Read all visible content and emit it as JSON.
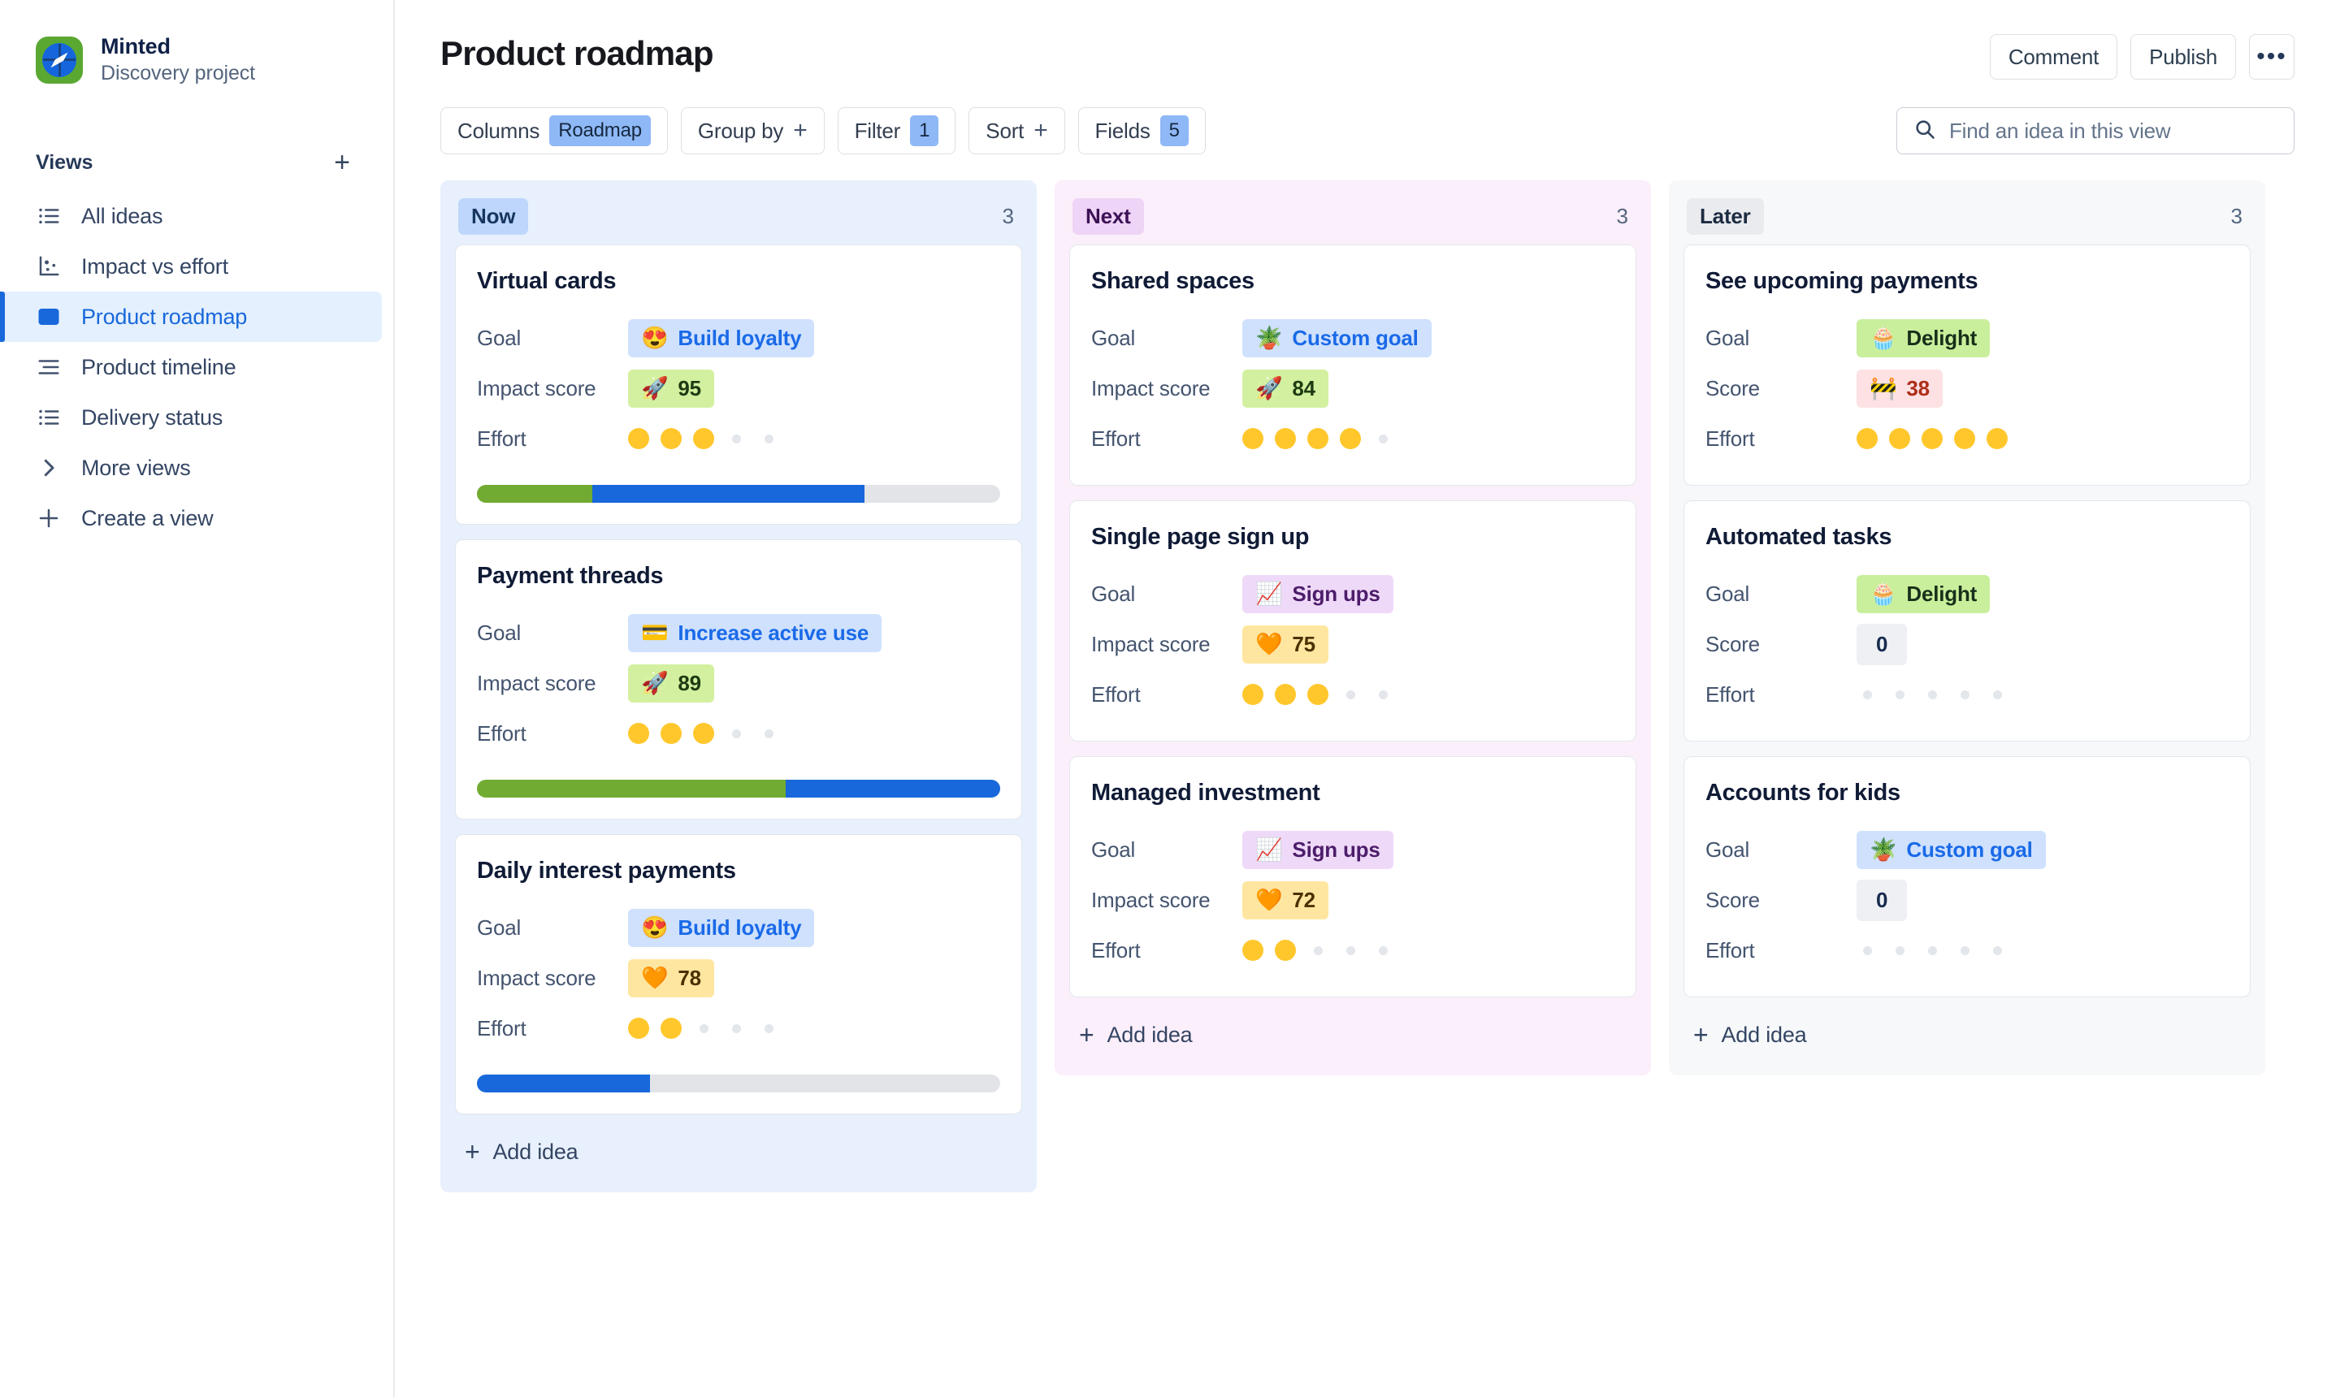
{
  "sidebar": {
    "brand": {
      "name": "Minted",
      "subtitle": "Discovery project",
      "logo_icon": "compass-icon"
    },
    "views_heading": "Views",
    "add_view_label": "+",
    "items": [
      {
        "label": "All ideas",
        "icon": "list-icon",
        "active": false
      },
      {
        "label": "Impact vs effort",
        "icon": "scatter-chart-icon",
        "active": false
      },
      {
        "label": "Product roadmap",
        "icon": "board-columns-icon",
        "active": true
      },
      {
        "label": "Product timeline",
        "icon": "timeline-icon",
        "active": false
      },
      {
        "label": "Delivery status",
        "icon": "list-icon",
        "active": false
      },
      {
        "label": "More views",
        "icon": "chevron-right-icon",
        "active": false
      },
      {
        "label": "Create a view",
        "icon": "plus-icon",
        "active": false
      }
    ]
  },
  "header": {
    "title": "Product roadmap",
    "comment_label": "Comment",
    "publish_label": "Publish",
    "more_label": "•••"
  },
  "toolbar": {
    "columns_label": "Columns",
    "columns_value": "Roadmap",
    "group_by_label": "Group by",
    "group_by_plus": "+",
    "filter_label": "Filter",
    "filter_count": "1",
    "sort_label": "Sort",
    "sort_plus": "+",
    "fields_label": "Fields",
    "fields_count": "5",
    "search_placeholder": "Find an idea in this view",
    "search_value": "",
    "search_icon": "search-icon"
  },
  "colors": {
    "accent_blue": "#1868db",
    "now_bg": "#e8f0fd",
    "now_badge": "#bed6fb",
    "next_bg": "#fbeffb",
    "next_badge": "#eed4f6",
    "later_bg": "#f6f8fa",
    "later_badge": "#e9ebee",
    "effort_dot": "#ffc72c",
    "progress_green": "#72ab31",
    "progress_blue": "#1868db",
    "progress_track": "#e2e4e8"
  },
  "board": {
    "add_idea_label": "Add idea",
    "columns": [
      {
        "name": "Now",
        "count": "3",
        "bg": "#e8f0fd",
        "badge_bg": "#bed6fb",
        "badge_color": "#16365f",
        "cards": [
          {
            "title": "Virtual cards",
            "fields": [
              {
                "label": "Goal",
                "type": "tag",
                "style": "blue",
                "emoji": "😍",
                "emoji_name": "smiling-face-with-hearts-icon",
                "value": "Build loyalty"
              },
              {
                "label": "Impact score",
                "type": "tag",
                "style": "greenlite",
                "emoji": "🚀",
                "emoji_name": "rocket-icon",
                "value": "95"
              },
              {
                "label": "Effort",
                "type": "dots",
                "filled": 3,
                "total": 5
              }
            ],
            "progress": {
              "green": 22,
              "blue": 52,
              "track": 26
            }
          },
          {
            "title": "Payment threads",
            "fields": [
              {
                "label": "Goal",
                "type": "tag",
                "style": "blue",
                "emoji": "💳",
                "emoji_name": "credit-card-icon",
                "value": "Increase active use"
              },
              {
                "label": "Impact score",
                "type": "tag",
                "style": "greenlite",
                "emoji": "🚀",
                "emoji_name": "rocket-icon",
                "value": "89"
              },
              {
                "label": "Effort",
                "type": "dots",
                "filled": 3,
                "total": 5
              }
            ],
            "progress": {
              "green": 59,
              "blue": 41,
              "track": 0
            }
          },
          {
            "title": "Daily interest payments",
            "fields": [
              {
                "label": "Goal",
                "type": "tag",
                "style": "blue",
                "emoji": "😍",
                "emoji_name": "smiling-face-with-hearts-icon",
                "value": "Build loyalty"
              },
              {
                "label": "Impact score",
                "type": "tag",
                "style": "yellow",
                "emoji": "🧡",
                "emoji_name": "orange-heart-icon",
                "value": "78"
              },
              {
                "label": "Effort",
                "type": "dots",
                "filled": 2,
                "total": 5
              }
            ],
            "progress": {
              "green": 0,
              "blue": 33,
              "track": 67
            }
          }
        ]
      },
      {
        "name": "Next",
        "count": "3",
        "bg": "#fbeffb",
        "badge_bg": "#eed4f6",
        "badge_color": "#3d1155",
        "cards": [
          {
            "title": "Shared spaces",
            "fields": [
              {
                "label": "Goal",
                "type": "tag",
                "style": "blue",
                "emoji": "🪴",
                "emoji_name": "potted-plant-icon",
                "value": "Custom goal"
              },
              {
                "label": "Impact score",
                "type": "tag",
                "style": "greenlite",
                "emoji": "🚀",
                "emoji_name": "rocket-icon",
                "value": "84"
              },
              {
                "label": "Effort",
                "type": "dots",
                "filled": 4,
                "total": 5
              }
            ],
            "progress": null
          },
          {
            "title": "Single page sign up",
            "fields": [
              {
                "label": "Goal",
                "type": "tag",
                "style": "purple",
                "emoji": "📈",
                "emoji_name": "chart-increasing-icon",
                "value": "Sign ups"
              },
              {
                "label": "Impact score",
                "type": "tag",
                "style": "yellow",
                "emoji": "🧡",
                "emoji_name": "orange-heart-icon",
                "value": "75"
              },
              {
                "label": "Effort",
                "type": "dots",
                "filled": 3,
                "total": 5
              }
            ],
            "progress": null
          },
          {
            "title": "Managed investment",
            "fields": [
              {
                "label": "Goal",
                "type": "tag",
                "style": "purple",
                "emoji": "📈",
                "emoji_name": "chart-increasing-icon",
                "value": "Sign ups"
              },
              {
                "label": "Impact score",
                "type": "tag",
                "style": "yellow",
                "emoji": "🧡",
                "emoji_name": "orange-heart-icon",
                "value": "72"
              },
              {
                "label": "Effort",
                "type": "dots",
                "filled": 2,
                "total": 5
              }
            ],
            "progress": null
          }
        ]
      },
      {
        "name": "Later",
        "count": "3",
        "bg": "#f6f8fa",
        "badge_bg": "#e9ebee",
        "badge_color": "#1c2b40",
        "cards": [
          {
            "title": "See upcoming payments",
            "fields": [
              {
                "label": "Goal",
                "type": "tag",
                "style": "green",
                "emoji": "🧁",
                "emoji_name": "cupcake-icon",
                "value": "Delight"
              },
              {
                "label": "Score",
                "type": "tag",
                "style": "pink",
                "emoji": "🚧",
                "emoji_name": "construction-icon",
                "value": "38"
              },
              {
                "label": "Effort",
                "type": "dots",
                "filled": 5,
                "total": 5
              }
            ],
            "progress": null
          },
          {
            "title": "Automated tasks",
            "fields": [
              {
                "label": "Goal",
                "type": "tag",
                "style": "green",
                "emoji": "🧁",
                "emoji_name": "cupcake-icon",
                "value": "Delight"
              },
              {
                "label": "Score",
                "type": "tag",
                "style": "gray",
                "emoji": "",
                "emoji_name": "",
                "value": "0"
              },
              {
                "label": "Effort",
                "type": "dots",
                "filled": 0,
                "total": 5
              }
            ],
            "progress": null
          },
          {
            "title": "Accounts for kids",
            "fields": [
              {
                "label": "Goal",
                "type": "tag",
                "style": "blue",
                "emoji": "🪴",
                "emoji_name": "potted-plant-icon",
                "value": "Custom goal"
              },
              {
                "label": "Score",
                "type": "tag",
                "style": "gray",
                "emoji": "",
                "emoji_name": "",
                "value": "0"
              },
              {
                "label": "Effort",
                "type": "dots",
                "filled": 0,
                "total": 5
              }
            ],
            "progress": null
          }
        ]
      }
    ]
  }
}
